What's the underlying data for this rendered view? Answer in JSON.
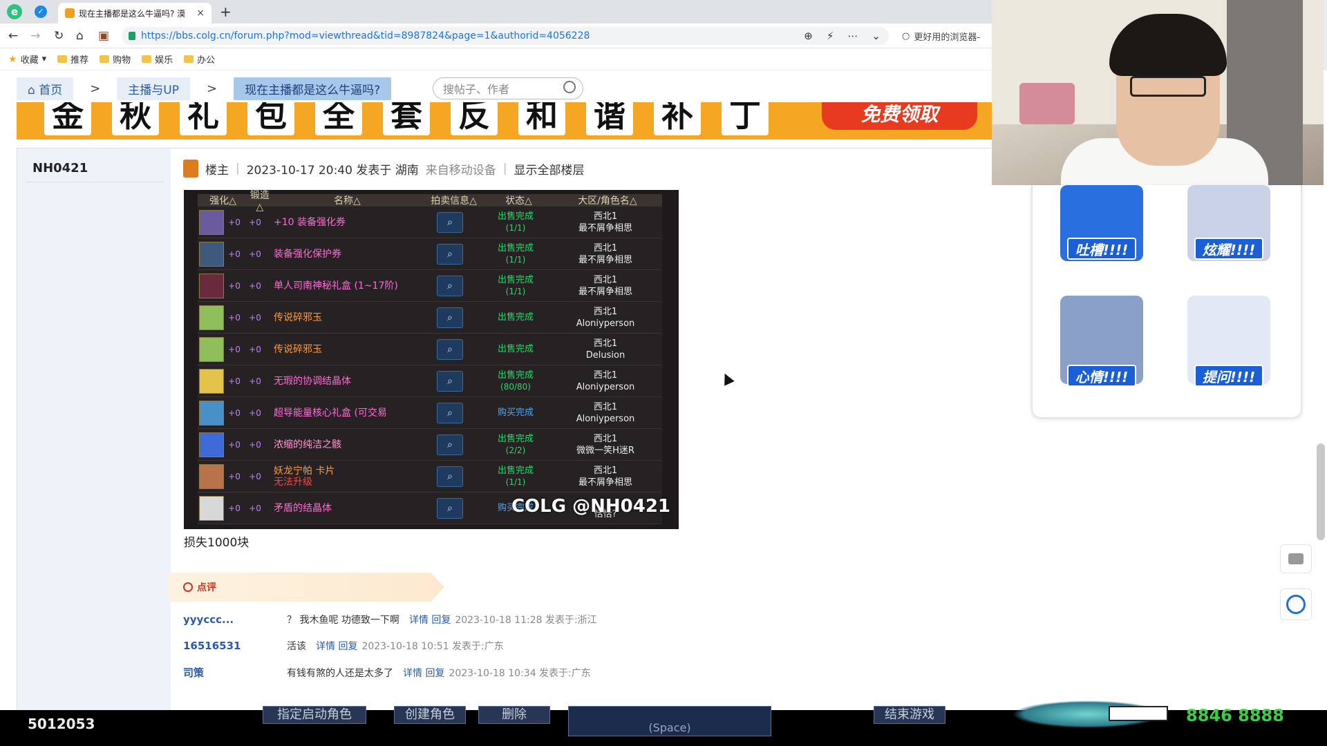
{
  "browser": {
    "tab_title": "现在主播都是这么牛逼吗? 漠",
    "tab_close": "×",
    "new_tab": "+",
    "url": "https://bbs.colg.cn/forum.php?mod=viewthread&tid=8987824&page=1&authorid=4056228",
    "search_hint": "更好用的浏览器-",
    "bookmarks": [
      "收藏",
      "推荐",
      "购物",
      "娱乐",
      "办公"
    ]
  },
  "breadcrumb": {
    "home": "首页",
    "section": "主播与UP",
    "thread": "现在主播都是这么牛逼吗?",
    "sep": ">"
  },
  "search": {
    "placeholder": "搜帖子、作者"
  },
  "banner": {
    "chars": [
      "金",
      "秋",
      "礼",
      "包",
      "全",
      "套",
      "反",
      "和",
      "谐",
      "补",
      "丁"
    ],
    "cta": "免费领取"
  },
  "post": {
    "author": "NH0421",
    "role": "楼主",
    "time": "2023-10-17 20:40 发表于 湖南",
    "device": "来自移动设备",
    "sep": "|",
    "show_all": "显示全部楼层",
    "body_text": "损失1000块"
  },
  "game_table": {
    "headers": [
      "强化△",
      "锻造△",
      "名称△",
      "拍卖信息△",
      "状态△",
      "大区/角色名△"
    ],
    "watermark": "COLG @NH0421",
    "rows": [
      {
        "p1": "+0",
        "p2": "+0",
        "name": "+10 装备强化券",
        "name_color": "#ff6ad5",
        "state": "出售完成",
        "state_sub": "(1/1)",
        "server": "西北1",
        "role": "最不屑争相思",
        "icon": "#6a5a9e"
      },
      {
        "p1": "+0",
        "p2": "+0",
        "name": "装备强化保护券",
        "name_color": "#ff6ad5",
        "state": "出售完成",
        "state_sub": "(1/1)",
        "server": "西北1",
        "role": "最不屑争相思",
        "icon": "#3d5a7e"
      },
      {
        "p1": "+0",
        "p2": "+0",
        "name": "单人司南神秘礼盒 (1~17阶)",
        "name_color": "#ff6ad5",
        "state": "出售完成",
        "state_sub": "(1/1)",
        "server": "西北1",
        "role": "最不屑争相思",
        "icon": "#6a2a3e"
      },
      {
        "p1": "+0",
        "p2": "+0",
        "name": "传说碎邪玉",
        "name_color": "#ff9a3c",
        "state": "出售完成",
        "state_sub": "",
        "server": "西北1",
        "role": "Aloniyperson",
        "icon": "#8fbf5a"
      },
      {
        "p1": "+0",
        "p2": "+0",
        "name": "传说碎邪玉",
        "name_color": "#ff9a3c",
        "state": "出售完成",
        "state_sub": "",
        "server": "西北1",
        "role": "Delusion",
        "icon": "#8fbf5a"
      },
      {
        "p1": "+0",
        "p2": "+0",
        "name": "无瑕的协调结晶体",
        "name_color": "#ff6ad5",
        "state": "出售完成",
        "state_sub": "(80/80)",
        "server": "西北1",
        "role": "Aloniyperson",
        "icon": "#e3c34a"
      },
      {
        "p1": "+0",
        "p2": "+0",
        "name": "超导能量核心礼盒 (可交易",
        "name_color": "#ff6ad5",
        "state": "购买完成",
        "state_sub": "",
        "server": "西北1",
        "role": "Aloniyperson",
        "icon": "#4a90c8"
      },
      {
        "p1": "+0",
        "p2": "+0",
        "name": "浓缩的纯洁之骸",
        "name_color": "#ff9ad5",
        "state": "出售完成",
        "state_sub": "(2/2)",
        "server": "西北1",
        "role": "微微一笑H迷R",
        "icon": "#3d6ad8"
      },
      {
        "p1": "+0",
        "p2": "+0",
        "name": "妖龙宁帕 卡片",
        "name_color": "#ff9a3c",
        "name2": "无法升级",
        "state": "出售完成",
        "state_sub": "(1/1)",
        "server": "西北1",
        "role": "最不屑争相思",
        "icon": "#b8734a"
      },
      {
        "p1": "+0",
        "p2": "+0",
        "name": "矛盾的结晶体",
        "name_color": "#ff6ad5",
        "state": "购买完成",
        "state_sub": "",
        "server": "",
        "role": "恬恬?",
        "icon": "#d8d8d8"
      }
    ]
  },
  "rating": {
    "label": "点评"
  },
  "comments": [
    {
      "user": "yyyccc...",
      "text": "？ 我木鱼呢 功德致一下啊",
      "links": "详情 回复",
      "meta": "2023-10-18 11:28 发表于:浙江"
    },
    {
      "user": "16516531",
      "text": "活该",
      "links": "详情 回复",
      "meta": "2023-10-18 10:51 发表于:广东"
    },
    {
      "user": "司策",
      "text": "有钱有煞的人还是太多了",
      "links": "详情 回复",
      "meta": "2023-10-18 10:34 发表于:广东"
    }
  ],
  "stickers": [
    {
      "label": "吐槽!!!!",
      "color": "#2a6fe0"
    },
    {
      "label": "炫耀!!!!",
      "color": "#9fb8e8"
    },
    {
      "label": "心情!!!!",
      "color": "#8aa0c8"
    },
    {
      "label": "提问!!!!",
      "color": "#c9d2e6"
    }
  ],
  "gamebar": {
    "viewer_id": "5012053",
    "buttons": [
      "指定启动角色",
      "创建角色",
      "删除",
      "结束游戏"
    ],
    "space_label": "(Space)",
    "counter": "8846 8888"
  }
}
